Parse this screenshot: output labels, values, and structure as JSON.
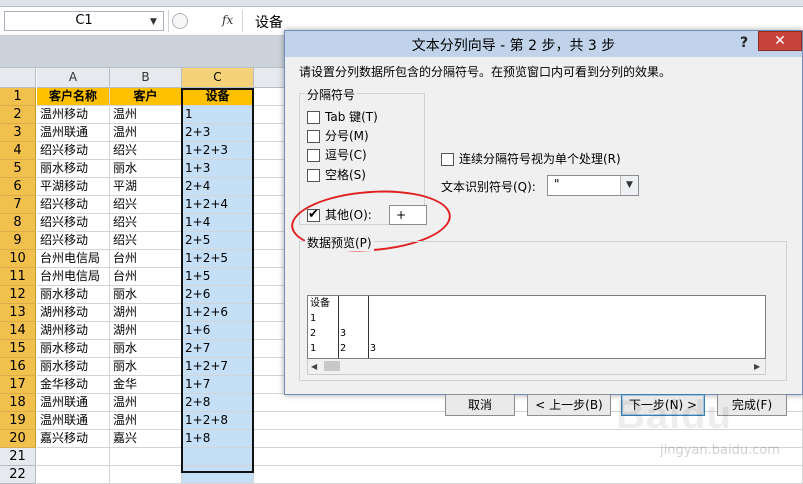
{
  "formula_bar": {
    "name_box": "C1",
    "fx_label": "fx",
    "content": "设备"
  },
  "sheet": {
    "columns": [
      "A",
      "B",
      "C"
    ],
    "rows": [
      {
        "num": "1",
        "a": "客户名称",
        "b": "客户",
        "c": "设备"
      },
      {
        "num": "2",
        "a": "温州移动",
        "b": "温州",
        "c": "1"
      },
      {
        "num": "3",
        "a": "温州联通",
        "b": "温州",
        "c": "2+3"
      },
      {
        "num": "4",
        "a": "绍兴移动",
        "b": "绍兴",
        "c": "1+2+3"
      },
      {
        "num": "5",
        "a": "丽水移动",
        "b": "丽水",
        "c": "1+3"
      },
      {
        "num": "6",
        "a": "平湖移动",
        "b": "平湖",
        "c": "2+4"
      },
      {
        "num": "7",
        "a": "绍兴移动",
        "b": "绍兴",
        "c": "1+2+4"
      },
      {
        "num": "8",
        "a": "绍兴移动",
        "b": "绍兴",
        "c": "1+4"
      },
      {
        "num": "9",
        "a": "绍兴移动",
        "b": "绍兴",
        "c": "2+5"
      },
      {
        "num": "10",
        "a": "台州电信局",
        "b": "台州",
        "c": "1+2+5"
      },
      {
        "num": "11",
        "a": "台州电信局",
        "b": "台州",
        "c": "1+5"
      },
      {
        "num": "12",
        "a": "丽水移动",
        "b": "丽水",
        "c": "2+6"
      },
      {
        "num": "13",
        "a": "湖州移动",
        "b": "湖州",
        "c": "1+2+6"
      },
      {
        "num": "14",
        "a": "湖州移动",
        "b": "湖州",
        "c": "1+6"
      },
      {
        "num": "15",
        "a": "丽水移动",
        "b": "丽水",
        "c": "2+7"
      },
      {
        "num": "16",
        "a": "丽水移动",
        "b": "丽水",
        "c": "1+2+7"
      },
      {
        "num": "17",
        "a": "金华移动",
        "b": "金华",
        "c": "1+7"
      },
      {
        "num": "18",
        "a": "温州联通",
        "b": "温州",
        "c": "2+8"
      },
      {
        "num": "19",
        "a": "温州联通",
        "b": "温州",
        "c": "1+2+8"
      },
      {
        "num": "20",
        "a": "嘉兴移动",
        "b": "嘉兴",
        "c": "1+8"
      },
      {
        "num": "21",
        "a": "",
        "b": "",
        "c": ""
      },
      {
        "num": "22",
        "a": "",
        "b": "",
        "c": ""
      }
    ]
  },
  "dialog": {
    "title": "文本分列向导 - 第 2 步，共 3 步",
    "help": "?",
    "close": "✕",
    "instruction": "请设置分列数据所包含的分隔符号。在预览窗口内可看到分列的效果。",
    "delimiters_legend": "分隔符号",
    "delimiters": [
      {
        "label": "Tab 键(T)",
        "checked": false
      },
      {
        "label": "分号(M)",
        "checked": false
      },
      {
        "label": "逗号(C)",
        "checked": false
      },
      {
        "label": "空格(S)",
        "checked": false
      },
      {
        "label": "其他(O):",
        "checked": true
      }
    ],
    "other_value": "+",
    "consecutive_label": "连续分隔符号视为单个处理(R)",
    "qualifier_label": "文本识别符号(Q):",
    "qualifier_value": "\"",
    "preview_legend": "数据预览(P)",
    "preview_rows": [
      [
        "设备",
        "",
        ""
      ],
      [
        "1",
        "",
        ""
      ],
      [
        "2",
        "3",
        ""
      ],
      [
        "1",
        "2",
        "3"
      ]
    ],
    "buttons": {
      "cancel": "取消",
      "back": "< 上一步(B)",
      "next": "下一步(N) >",
      "finish": "完成(F)"
    }
  },
  "watermark": {
    "logo": "Baidu",
    "sub": "jingyan.baidu.com"
  },
  "colors": {
    "header_fill": "#ffc000",
    "selected_column": "#c5dff7",
    "row_header": "#f2c14d",
    "annotation": "#e02020",
    "dialog_title": "#c1d3ea",
    "close_button": "#c7443a"
  }
}
